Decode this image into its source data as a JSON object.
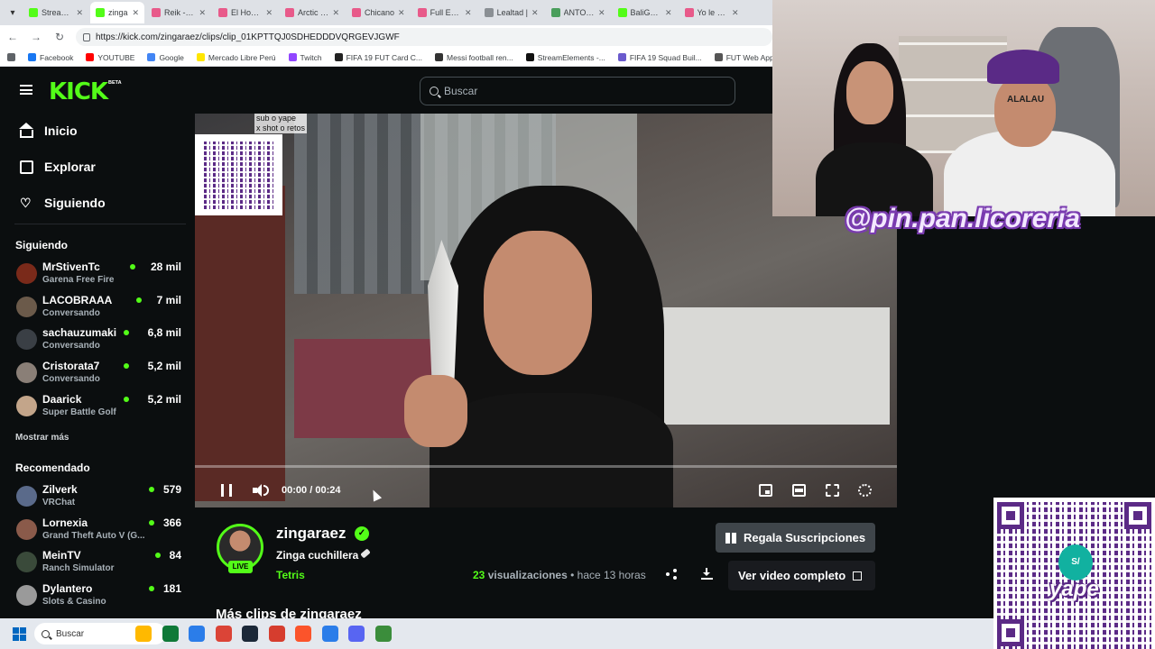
{
  "browser": {
    "tabs": [
      {
        "label": "Stream - K",
        "color": "#53fc18",
        "active": false
      },
      {
        "label": "zinga",
        "color": "#53fc18",
        "active": true
      },
      {
        "label": "Reik - Yo",
        "color": "#e85a8a",
        "active": false
      },
      {
        "label": "El House",
        "color": "#e85a8a",
        "active": false
      },
      {
        "label": "Arctic Mo",
        "color": "#e85a8a",
        "active": false
      },
      {
        "label": "Chicano",
        "color": "#e85a8a",
        "active": false
      },
      {
        "label": "Full Englis",
        "color": "#e85a8a",
        "active": false
      },
      {
        "label": "Lealtad |",
        "color": "#8a8f94",
        "active": false
      },
      {
        "label": "ANTONIO",
        "color": "#4a9e5c",
        "active": false
      },
      {
        "label": "BaliGamin",
        "color": "#53fc18",
        "active": false
      },
      {
        "label": "Yo le Doy",
        "color": "#e85a8a",
        "active": false
      }
    ],
    "url": "https://kick.com/zingaraez/clips/clip_01KPTTQJ0SDHEDDDVQRGEVJGWF",
    "bookmarks": [
      {
        "label": "Facebook",
        "color": "#1877f2"
      },
      {
        "label": "YOUTUBE",
        "color": "#ff0000"
      },
      {
        "label": "Google",
        "color": "#4285f4"
      },
      {
        "label": "Mercado Libre Perú",
        "color": "#ffe600"
      },
      {
        "label": "Twitch",
        "color": "#9146ff"
      },
      {
        "label": "FIFA 19 FUT Card C...",
        "color": "#222"
      },
      {
        "label": "Messi football ren...",
        "color": "#333"
      },
      {
        "label": "StreamElements -...",
        "color": "#111"
      },
      {
        "label": "FIFA 19 Squad Buil...",
        "color": "#6a5acd"
      },
      {
        "label": "FUT Web App - EA...",
        "color": "#555"
      }
    ]
  },
  "header": {
    "logo": "KICK",
    "beta": "BETA",
    "search_placeholder": "Buscar"
  },
  "sidebar": {
    "nav": [
      {
        "label": "Inicio",
        "icon": "home-icon"
      },
      {
        "label": "Explorar",
        "icon": "browse-icon"
      },
      {
        "label": "Siguiendo",
        "icon": "heart-icon"
      }
    ],
    "following_title": "Siguiendo",
    "following": [
      {
        "name": "MrStivenTc",
        "category": "Garena Free Fire",
        "viewers": "28 mil",
        "avatar": "#7a2a1a"
      },
      {
        "name": "LACOBRAAA",
        "category": "Conversando",
        "viewers": "7 mil",
        "avatar": "#6b5a4a"
      },
      {
        "name": "sachauzumaki",
        "category": "Conversando",
        "viewers": "6,8 mil",
        "avatar": "#3a3f45"
      },
      {
        "name": "Cristorata7",
        "category": "Conversando",
        "viewers": "5,2 mil",
        "avatar": "#8a7f77"
      },
      {
        "name": "Daarick",
        "category": "Super Battle Golf",
        "viewers": "5,2 mil",
        "avatar": "#c3a58a"
      }
    ],
    "show_more": "Mostrar más",
    "recommended_title": "Recomendado",
    "recommended": [
      {
        "name": "Zilverk",
        "category": "VRChat",
        "viewers": "579",
        "avatar": "#5a6a8a"
      },
      {
        "name": "Lornexia",
        "category": "Grand Theft Auto V (G...",
        "viewers": "366",
        "avatar": "#8a5a4a"
      },
      {
        "name": "MeinTV",
        "category": "Ranch Simulator",
        "viewers": "84",
        "avatar": "#3a4a3a"
      },
      {
        "name": "Dylantero",
        "category": "Slots & Casino",
        "viewers": "181",
        "avatar": "#9a9a9a"
      }
    ]
  },
  "video": {
    "overlay_text_1": "sub o yape",
    "overlay_text_2": "x shot o retos",
    "time_current": "00:00",
    "time_total": "00:24",
    "time_separator": "/"
  },
  "clip": {
    "channel_name": "zingaraez",
    "live_badge": "LIVE",
    "title": "Zinga cuchillera",
    "category": "Tetris",
    "views_count": "23",
    "views_label": "visualizaciones",
    "separator": "•",
    "time_ago": "hace 13 horas",
    "gift_button": "Regala Suscripciones",
    "full_video_button": "Ver video completo",
    "more_clips": "Más clips de zingaraez"
  },
  "stream_overlay": {
    "instagram_tag": "@pin.pan.licoreria",
    "yape_label": "yape",
    "yape_logo": "S/",
    "shirt_text": "ALALAU"
  },
  "taskbar": {
    "search_placeholder": "Buscar",
    "apps": [
      "#ffb900",
      "#0f7938",
      "#2b7de9",
      "#db4437",
      "#1b2838",
      "#d63d2e",
      "#fb542b",
      "#2b7de9",
      "#5865f2",
      "#3b8d3b"
    ]
  }
}
